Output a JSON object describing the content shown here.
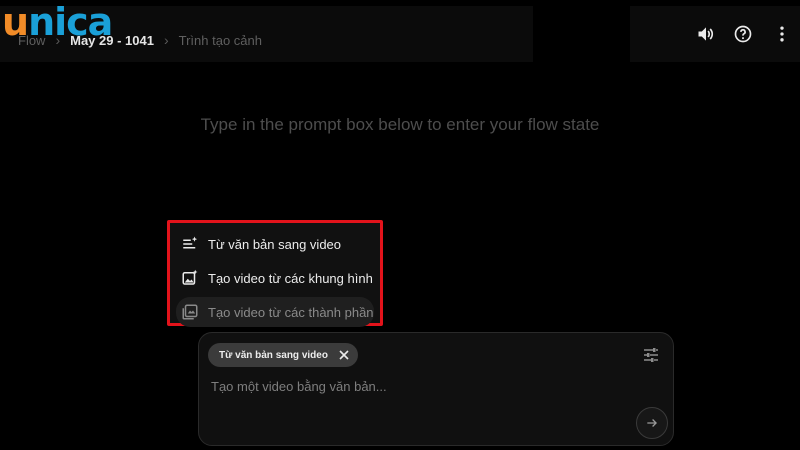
{
  "logo": {
    "text_first": "u",
    "text_rest": "nica",
    "colors": {
      "u": "#f28c28",
      "rest": "#1aa0d8"
    }
  },
  "breadcrumb": {
    "root": "Flow",
    "project": "May 29 - 1041",
    "page": "Trình tạo cảnh"
  },
  "toolbar": {
    "icons": [
      "volume-icon",
      "help-icon",
      "more-vert-icon"
    ]
  },
  "hint": "Type in the prompt box below to enter your flow state",
  "mode_menu": {
    "highlight_color": "#e3131b",
    "items": [
      {
        "label": "Từ văn bản sang video",
        "icon": "text-sparkle-icon",
        "disabled": false
      },
      {
        "label": "Tạo video từ các khung hình",
        "icon": "image-sparkle-icon",
        "disabled": false
      },
      {
        "label": "Tạo video từ các thành phần",
        "icon": "ingredients-icon",
        "disabled": true
      }
    ]
  },
  "composer": {
    "chip_label": "Từ văn bản sang video",
    "placeholder": "Tạo một video bằng văn bản...",
    "value": ""
  }
}
